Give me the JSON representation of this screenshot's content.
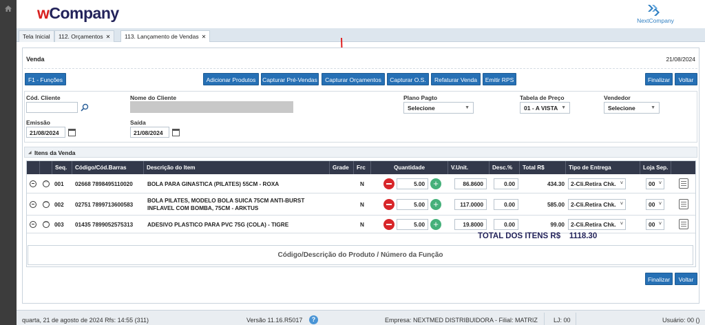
{
  "header": {
    "logo_prefix": "w",
    "logo_rest": "Company",
    "brand_right": "NextCompany"
  },
  "tabs": [
    {
      "label": "Tela Inicial",
      "close": ""
    },
    {
      "label": "112. Orçamentos",
      "close": "✕"
    },
    {
      "label": "113. Lançamento de Vendas",
      "close": "✕"
    }
  ],
  "venda": {
    "title": "Venda",
    "date": "21/08/2024"
  },
  "toolbar": {
    "f1": "F1 - Funções",
    "adicionar": "Adicionar Produtos",
    "capt_pre": "Capturar Pré-Vendas",
    "capt_orc": "Capturar Orçamentos",
    "capt_os": "Capturar O.S.",
    "refaturar": "Refaturar Venda",
    "emitir": "Emitir RPS",
    "finalizar": "Finalizar",
    "voltar": "Voltar"
  },
  "form": {
    "cod_cliente_label": "Cód. Cliente",
    "cod_cliente_value": "",
    "nome_cliente_label": "Nome do Cliente",
    "plano_label": "Plano Pagto",
    "plano_value": "Selecione",
    "tabela_label": "Tabela de Preço",
    "tabela_value": "01 - A VISTA",
    "vendedor_label": "Vendedor",
    "vendedor_value": "Selecione",
    "emissao_label": "Emissão",
    "emissao_value": "21/08/2024",
    "saida_label": "Saída",
    "saida_value": "21/08/2024"
  },
  "itens": {
    "title": "Itens da Venda"
  },
  "columns": {
    "seq": "Seq.",
    "codigo": "Código/Cód.Barras",
    "descricao": "Descrição do Item",
    "grade": "Grade",
    "frc": "Frc",
    "quantidade": "Quantidade",
    "vunit": "V.Unit.",
    "desc": "Desc.%",
    "total": "Total R$",
    "tipo": "Tipo de Entrega",
    "loja": "Loja Sep."
  },
  "rows": [
    {
      "seq": "001",
      "codigo": "02668 7898495110020",
      "desc_line1": "BOLA PARA GINASTICA (PILATES) 55CM - ROXA",
      "desc_line2": "",
      "frc": "N",
      "qtd": "5.00",
      "vunit": "86.8600",
      "desc": "0.00",
      "total": "434.30",
      "tipo": "2-Cli.Retira Chk.",
      "loja": "00"
    },
    {
      "seq": "002",
      "codigo": "02751 7899713600583",
      "desc_line1": "BOLA PILATES, MODELO BOLA SUICA 75CM ANTI-BURST",
      "desc_line2": "INFLAVEL COM BOMBA, 75CM - ARKTUS",
      "frc": "N",
      "qtd": "5.00",
      "vunit": "117.0000",
      "desc": "0.00",
      "total": "585.00",
      "tipo": "2-Cli.Retira Chk.",
      "loja": "00"
    },
    {
      "seq": "003",
      "codigo": "01435 7899052575313",
      "desc_line1": "ADESIVO PLASTICO PARA PVC 75G (COLA) - TIGRE",
      "desc_line2": "",
      "frc": "N",
      "qtd": "5.00",
      "vunit": "19.8000",
      "desc": "0.00",
      "total": "99.00",
      "tipo": "2-Cli.Retira Chk.",
      "loja": "00"
    }
  ],
  "totals": {
    "label": "TOTAL DOS ITENS R$",
    "value": "1118.30"
  },
  "search": {
    "placeholder": "Código/Descrição do Produto / Número da Função"
  },
  "footer": {
    "date": "quarta, 21 de agosto de 2024  Rfs: 14:55 (311)",
    "versao": "Versão 11.16.R5017",
    "help": "?",
    "empresa": "Empresa: NEXTMED DISTRIBUIDORA - Filial: MATRIZ",
    "lj": "LJ: 00",
    "usuario": "Usuário: 00 ()"
  },
  "colors": {
    "accent": "#2670b5",
    "header_dark": "#33394b",
    "remove": "#d8262a",
    "add": "#45b07a",
    "annotation": "#e02020"
  }
}
